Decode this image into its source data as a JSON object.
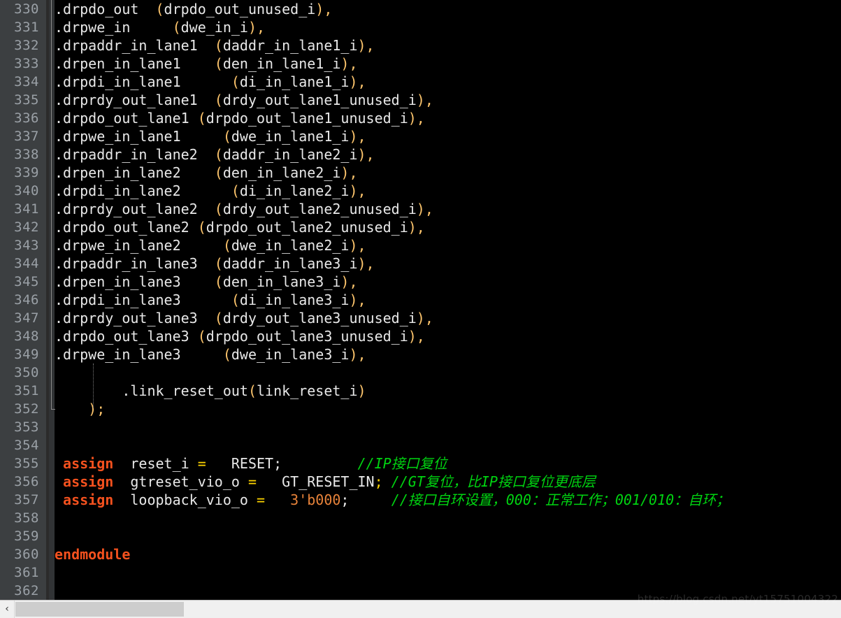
{
  "editor": {
    "first_line_number": 330,
    "last_line_number": 362,
    "language": "verilog",
    "colors": {
      "background": "#000000",
      "gutter": "#3c3f41",
      "linenumber": "#9aa0a6",
      "identifier": "#e8e8e8",
      "keyword": "#f4511e",
      "paren": "#ffc66d",
      "operator": "#ffd500",
      "number": "#e8833a",
      "comment": "#00d411",
      "scrollbar_thumb": "#cdcdcd"
    }
  },
  "line_numbers": [
    "330",
    "331",
    "332",
    "333",
    "334",
    "335",
    "336",
    "337",
    "338",
    "339",
    "340",
    "341",
    "342",
    "343",
    "344",
    "345",
    "346",
    "347",
    "348",
    "349",
    "350",
    "351",
    "352",
    "353",
    "354",
    "355",
    "356",
    "357",
    "358",
    "359",
    "360",
    "361",
    "362"
  ],
  "lines": [
    {
      "n": "330",
      "tokens": [
        {
          "t": ".drpdo_out  ",
          "c": "white"
        },
        {
          "t": "(",
          "c": "yellow"
        },
        {
          "t": "drpdo_out_unused_i",
          "c": "white"
        },
        {
          "t": ")",
          "c": "yellow"
        },
        {
          "t": ",",
          "c": "yellow"
        }
      ]
    },
    {
      "n": "331",
      "tokens": [
        {
          "t": ".drpwe_in     ",
          "c": "white"
        },
        {
          "t": "(",
          "c": "yellow"
        },
        {
          "t": "dwe_in_i",
          "c": "white"
        },
        {
          "t": ")",
          "c": "yellow"
        },
        {
          "t": ",",
          "c": "yellow"
        }
      ]
    },
    {
      "n": "332",
      "tokens": [
        {
          "t": ".drpaddr_in_lane1  ",
          "c": "white"
        },
        {
          "t": "(",
          "c": "yellow"
        },
        {
          "t": "daddr_in_lane1_i",
          "c": "white"
        },
        {
          "t": ")",
          "c": "yellow"
        },
        {
          "t": ",",
          "c": "yellow"
        }
      ]
    },
    {
      "n": "333",
      "tokens": [
        {
          "t": ".drpen_in_lane1    ",
          "c": "white"
        },
        {
          "t": "(",
          "c": "yellow"
        },
        {
          "t": "den_in_lane1_i",
          "c": "white"
        },
        {
          "t": ")",
          "c": "yellow"
        },
        {
          "t": ",",
          "c": "yellow"
        }
      ]
    },
    {
      "n": "334",
      "tokens": [
        {
          "t": ".drpdi_in_lane1      ",
          "c": "white"
        },
        {
          "t": "(",
          "c": "yellow"
        },
        {
          "t": "di_in_lane1_i",
          "c": "white"
        },
        {
          "t": ")",
          "c": "yellow"
        },
        {
          "t": ",",
          "c": "yellow"
        }
      ]
    },
    {
      "n": "335",
      "tokens": [
        {
          "t": ".drprdy_out_lane1  ",
          "c": "white"
        },
        {
          "t": "(",
          "c": "yellow"
        },
        {
          "t": "drdy_out_lane1_unused_i",
          "c": "white"
        },
        {
          "t": ")",
          "c": "yellow"
        },
        {
          "t": ",",
          "c": "yellow"
        }
      ]
    },
    {
      "n": "336",
      "tokens": [
        {
          "t": ".drpdo_out_lane1 ",
          "c": "white"
        },
        {
          "t": "(",
          "c": "yellow"
        },
        {
          "t": "drpdo_out_lane1_unused_i",
          "c": "white"
        },
        {
          "t": ")",
          "c": "yellow"
        },
        {
          "t": ",",
          "c": "yellow"
        }
      ]
    },
    {
      "n": "337",
      "tokens": [
        {
          "t": ".drpwe_in_lane1     ",
          "c": "white"
        },
        {
          "t": "(",
          "c": "yellow"
        },
        {
          "t": "dwe_in_lane1_i",
          "c": "white"
        },
        {
          "t": ")",
          "c": "yellow"
        },
        {
          "t": ",",
          "c": "yellow"
        }
      ]
    },
    {
      "n": "338",
      "tokens": [
        {
          "t": ".drpaddr_in_lane2  ",
          "c": "white"
        },
        {
          "t": "(",
          "c": "yellow"
        },
        {
          "t": "daddr_in_lane2_i",
          "c": "white"
        },
        {
          "t": ")",
          "c": "yellow"
        },
        {
          "t": ",",
          "c": "yellow"
        }
      ]
    },
    {
      "n": "339",
      "tokens": [
        {
          "t": ".drpen_in_lane2    ",
          "c": "white"
        },
        {
          "t": "(",
          "c": "yellow"
        },
        {
          "t": "den_in_lane2_i",
          "c": "white"
        },
        {
          "t": ")",
          "c": "yellow"
        },
        {
          "t": ",",
          "c": "yellow"
        }
      ]
    },
    {
      "n": "340",
      "tokens": [
        {
          "t": ".drpdi_in_lane2      ",
          "c": "white"
        },
        {
          "t": "(",
          "c": "yellow"
        },
        {
          "t": "di_in_lane2_i",
          "c": "white"
        },
        {
          "t": ")",
          "c": "yellow"
        },
        {
          "t": ",",
          "c": "yellow"
        }
      ]
    },
    {
      "n": "341",
      "tokens": [
        {
          "t": ".drprdy_out_lane2  ",
          "c": "white"
        },
        {
          "t": "(",
          "c": "yellow"
        },
        {
          "t": "drdy_out_lane2_unused_i",
          "c": "white"
        },
        {
          "t": ")",
          "c": "yellow"
        },
        {
          "t": ",",
          "c": "yellow"
        }
      ]
    },
    {
      "n": "342",
      "tokens": [
        {
          "t": ".drpdo_out_lane2 ",
          "c": "white"
        },
        {
          "t": "(",
          "c": "yellow"
        },
        {
          "t": "drpdo_out_lane2_unused_i",
          "c": "white"
        },
        {
          "t": ")",
          "c": "yellow"
        },
        {
          "t": ",",
          "c": "yellow"
        }
      ]
    },
    {
      "n": "343",
      "tokens": [
        {
          "t": ".drpwe_in_lane2     ",
          "c": "white"
        },
        {
          "t": "(",
          "c": "yellow"
        },
        {
          "t": "dwe_in_lane2_i",
          "c": "white"
        },
        {
          "t": ")",
          "c": "yellow"
        },
        {
          "t": ",",
          "c": "yellow"
        }
      ]
    },
    {
      "n": "344",
      "tokens": [
        {
          "t": ".drpaddr_in_lane3  ",
          "c": "white"
        },
        {
          "t": "(",
          "c": "yellow"
        },
        {
          "t": "daddr_in_lane3_i",
          "c": "white"
        },
        {
          "t": ")",
          "c": "yellow"
        },
        {
          "t": ",",
          "c": "yellow"
        }
      ]
    },
    {
      "n": "345",
      "tokens": [
        {
          "t": ".drpen_in_lane3    ",
          "c": "white"
        },
        {
          "t": "(",
          "c": "yellow"
        },
        {
          "t": "den_in_lane3_i",
          "c": "white"
        },
        {
          "t": ")",
          "c": "yellow"
        },
        {
          "t": ",",
          "c": "yellow"
        }
      ]
    },
    {
      "n": "346",
      "tokens": [
        {
          "t": ".drpdi_in_lane3      ",
          "c": "white"
        },
        {
          "t": "(",
          "c": "yellow"
        },
        {
          "t": "di_in_lane3_i",
          "c": "white"
        },
        {
          "t": ")",
          "c": "yellow"
        },
        {
          "t": ",",
          "c": "yellow"
        }
      ]
    },
    {
      "n": "347",
      "tokens": [
        {
          "t": ".drprdy_out_lane3  ",
          "c": "white"
        },
        {
          "t": "(",
          "c": "yellow"
        },
        {
          "t": "drdy_out_lane3_unused_i",
          "c": "white"
        },
        {
          "t": ")",
          "c": "yellow"
        },
        {
          "t": ",",
          "c": "yellow"
        }
      ]
    },
    {
      "n": "348",
      "tokens": [
        {
          "t": ".drpdo_out_lane3 ",
          "c": "white"
        },
        {
          "t": "(",
          "c": "yellow"
        },
        {
          "t": "drpdo_out_lane3_unused_i",
          "c": "white"
        },
        {
          "t": ")",
          "c": "yellow"
        },
        {
          "t": ",",
          "c": "yellow"
        }
      ]
    },
    {
      "n": "349",
      "tokens": [
        {
          "t": ".drpwe_in_lane3     ",
          "c": "white"
        },
        {
          "t": "(",
          "c": "yellow"
        },
        {
          "t": "dwe_in_lane3_i",
          "c": "white"
        },
        {
          "t": ")",
          "c": "yellow"
        },
        {
          "t": ",",
          "c": "yellow"
        }
      ]
    },
    {
      "n": "350",
      "tokens": []
    },
    {
      "n": "351",
      "tokens": [
        {
          "t": "        .link_reset_out",
          "c": "white"
        },
        {
          "t": "(",
          "c": "yellow"
        },
        {
          "t": "link_reset_i",
          "c": "white"
        },
        {
          "t": ")",
          "c": "yellow"
        }
      ]
    },
    {
      "n": "352",
      "tokens": [
        {
          "t": "    ",
          "c": "white"
        },
        {
          "t": ")",
          "c": "yellow"
        },
        {
          "t": ";",
          "c": "yellow"
        }
      ]
    },
    {
      "n": "353",
      "tokens": []
    },
    {
      "n": "354",
      "tokens": []
    },
    {
      "n": "355",
      "tokens": [
        {
          "t": " ",
          "c": "white"
        },
        {
          "t": "assign",
          "c": "kw"
        },
        {
          "t": "  reset_i ",
          "c": "white"
        },
        {
          "t": "=",
          "c": "gold"
        },
        {
          "t": "   RESET",
          "c": "white"
        },
        {
          "t": ";",
          "c": "white"
        },
        {
          "t": "         ",
          "c": "white"
        },
        {
          "t": "//IP接口复位",
          "c": "cmt"
        }
      ]
    },
    {
      "n": "356",
      "tokens": [
        {
          "t": " ",
          "c": "white"
        },
        {
          "t": "assign",
          "c": "kw"
        },
        {
          "t": "  gtreset_vio_o ",
          "c": "white"
        },
        {
          "t": "=",
          "c": "gold"
        },
        {
          "t": "   GT_RESET_IN",
          "c": "white"
        },
        {
          "t": ";",
          "c": "gold"
        },
        {
          "t": " ",
          "c": "white"
        },
        {
          "t": "//GT复位，比IP接口复位更底层",
          "c": "cmt"
        }
      ]
    },
    {
      "n": "357",
      "tokens": [
        {
          "t": " ",
          "c": "white"
        },
        {
          "t": "assign",
          "c": "kw"
        },
        {
          "t": "  loopback_vio_o ",
          "c": "white"
        },
        {
          "t": "=",
          "c": "gold"
        },
        {
          "t": "   ",
          "c": "white"
        },
        {
          "t": "3'b000",
          "c": "num"
        },
        {
          "t": ";",
          "c": "white"
        },
        {
          "t": "     ",
          "c": "white"
        },
        {
          "t": "//接口自环设置，000：正常工作；001/010：自环；",
          "c": "cmt"
        }
      ]
    },
    {
      "n": "358",
      "tokens": []
    },
    {
      "n": "359",
      "tokens": []
    },
    {
      "n": "360",
      "tokens": [
        {
          "t": "endmodule",
          "c": "kw"
        }
      ]
    },
    {
      "n": "361",
      "tokens": []
    },
    {
      "n": "362",
      "tokens": []
    }
  ],
  "scrollbar": {
    "left_arrow_glyph": "‹",
    "orientation": "horizontal"
  },
  "watermark": {
    "text": "https://blog.csdn.net/yt15751004322"
  }
}
